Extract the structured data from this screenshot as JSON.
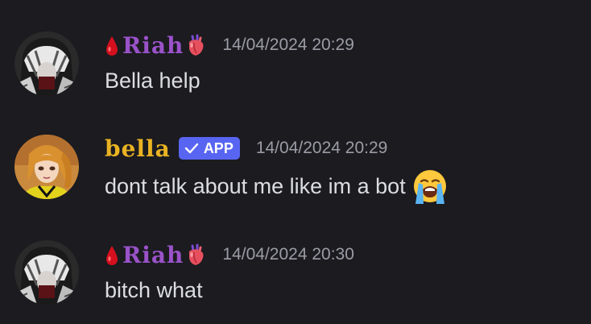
{
  "messages": [
    {
      "author": "Riah",
      "timestamp": "14/04/2024 20:29",
      "text": "Bella help",
      "author_color": "#9a52c9",
      "prefix_icon": "blood-drop-icon",
      "suffix_icon": "anatomical-heart-icon"
    },
    {
      "author": "bella",
      "badge": "APP",
      "timestamp": "14/04/2024 20:29",
      "text": "dont talk about me like im a bot",
      "emoji": "loudly-crying-face-icon",
      "author_color": "#e9b322",
      "badge_color": "#5865f2"
    },
    {
      "author": "Riah",
      "timestamp": "14/04/2024 20:30",
      "text": "bitch what",
      "author_color": "#9a52c9",
      "prefix_icon": "blood-drop-icon",
      "suffix_icon": "anatomical-heart-icon"
    }
  ]
}
